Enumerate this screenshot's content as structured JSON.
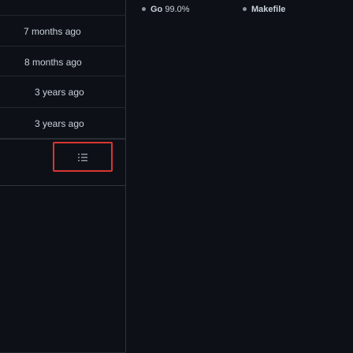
{
  "repos": {
    "rows": [
      {
        "updated": "7 months ago"
      },
      {
        "updated": "8 months ago"
      },
      {
        "updated": "3 years ago"
      },
      {
        "updated": "3 years ago"
      }
    ]
  },
  "pagination": {
    "icon": "list-icon"
  },
  "languages": {
    "go": {
      "name": "Go",
      "percent": "99.0%"
    },
    "makefile": {
      "name": "Makefile",
      "percent": ""
    }
  },
  "colors": {
    "background": "#0d1117",
    "border": "#30363d",
    "highlight": "#da3633",
    "text": "#c9d1d9"
  }
}
